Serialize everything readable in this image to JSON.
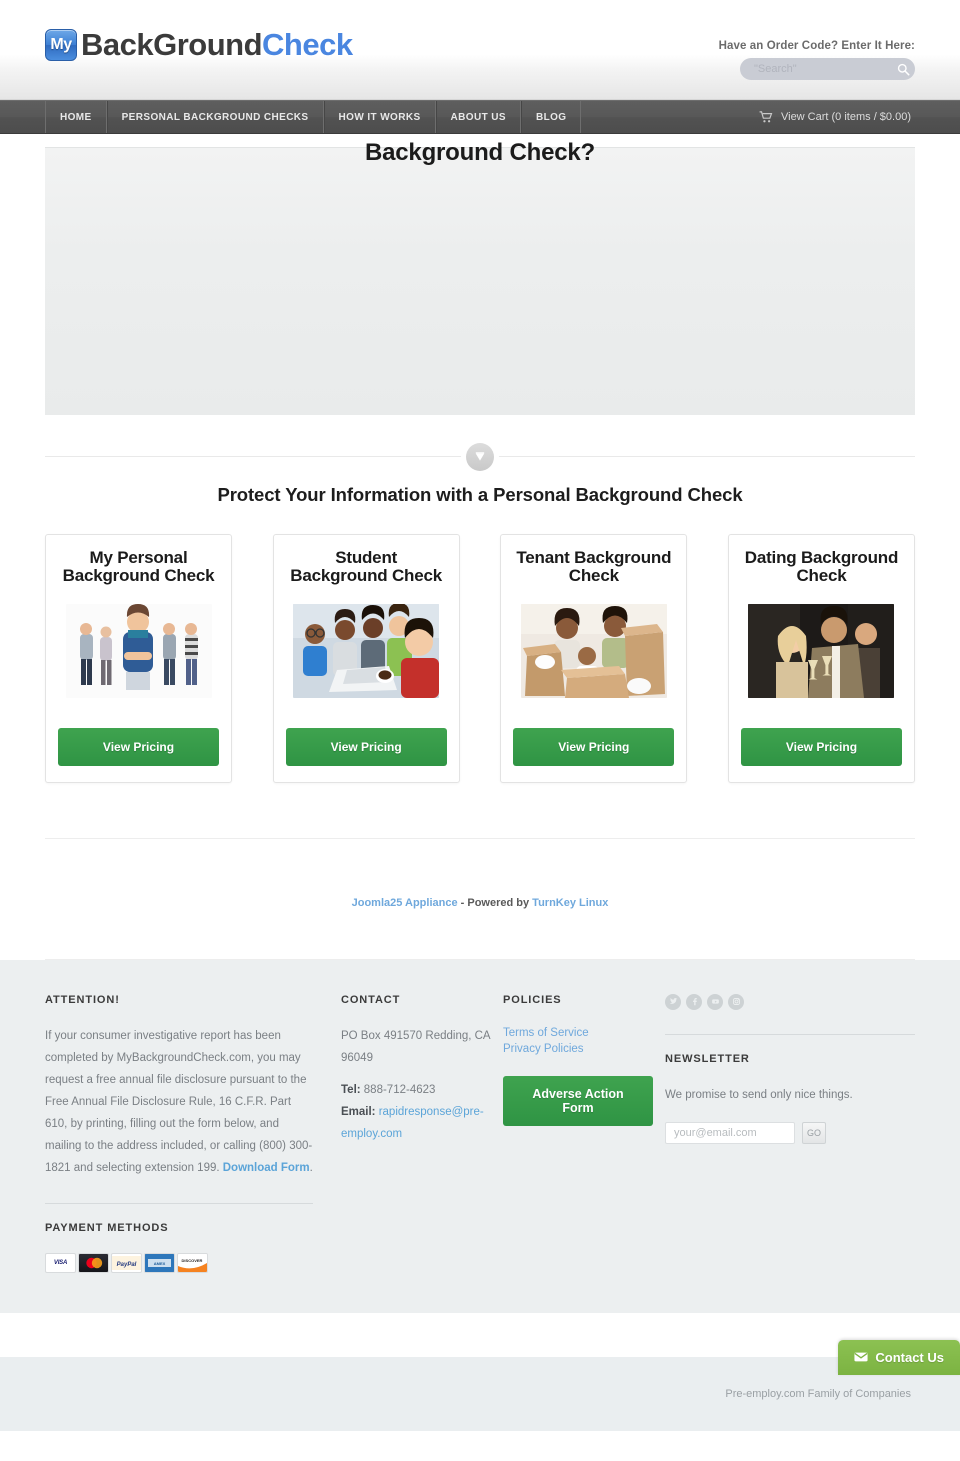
{
  "header": {
    "logo": {
      "badge": "My",
      "dark": "BackGround",
      "blue": "Check"
    },
    "order_code_label": "Have an Order Code? Enter It Here:",
    "search": {
      "placeholder": "\"Search\"",
      "value": "",
      "icon": "search-icon"
    }
  },
  "nav": {
    "items": [
      {
        "label": "HOME"
      },
      {
        "label": "PERSONAL BACKGROUND CHECKS"
      },
      {
        "label": "HOW IT WORKS"
      },
      {
        "label": "ABOUT US"
      },
      {
        "label": "BLOG"
      }
    ],
    "cart": {
      "label": "View Cart (0 items / $0.00)",
      "icon": "cart-icon"
    }
  },
  "hero": {
    "title": "Background Check?"
  },
  "scroll": {
    "icon": "arrow-down-circle-icon"
  },
  "main": {
    "section_title": "Protect Your Information with a Personal Background Check",
    "cards": [
      {
        "title": "My Personal Background Check",
        "button": "View Pricing",
        "image": "group-of-young-people-photo"
      },
      {
        "title": "Student Background Check",
        "button": "View Pricing",
        "image": "students-with-laptop-photo"
      },
      {
        "title": "Tenant Background Check",
        "button": "View Pricing",
        "image": "family-with-moving-boxes-photo"
      },
      {
        "title": "Dating Background Check",
        "button": "View Pricing",
        "image": "couple-toasting-photo"
      }
    ]
  },
  "powered": {
    "prefix": "Joomla25 Appliance",
    "middle": " - Powered by ",
    "suffix": "TurnKey Linux"
  },
  "footer": {
    "attention": {
      "heading": "ATTENTION!",
      "body": "If your consumer investigative report has been completed by MyBackgroundCheck.com, you may request a free annual file disclosure pursuant to the Free Annual File Disclosure Rule, 16 C.F.R. Part 610, by printing, filling out the form below, and mailing to the address included, or calling (800) 300-1821 and selecting extension 199. ",
      "download_link": "Download Form",
      "body_end": "."
    },
    "payment": {
      "heading": "PAYMENT METHODS",
      "cards": [
        "VISA",
        "MasterCard",
        "PayPal",
        "American Express",
        "Discover"
      ]
    },
    "contact": {
      "heading": "CONTACT",
      "address": "PO Box 491570 Redding, CA 96049",
      "tel_label": "Tel:",
      "tel": " 888-712-4623",
      "email_label": "Email:",
      "email": " rapidresponse@pre-employ.com"
    },
    "policies": {
      "heading": "POLICIES",
      "links": [
        "Terms of Service",
        "Privacy Policies"
      ],
      "button": "Adverse Action Form"
    },
    "social": {
      "icons": [
        "twitter-icon",
        "facebook-icon",
        "youtube-icon",
        "instagram-icon"
      ]
    },
    "newsletter": {
      "heading": "NEWSLETTER",
      "text": "We promise to send only nice things.",
      "placeholder": "your@email.com",
      "value": "",
      "go_label": "GO"
    }
  },
  "bottom": {
    "text": "Pre-employ.com Family of Companies"
  },
  "contact_us": {
    "label": "Contact Us",
    "icon": "envelope-icon"
  },
  "colors": {
    "green": "#2f9444",
    "nav_dark": "#555555",
    "link_blue": "#6fa8dc",
    "logo_blue": "#4a86e0",
    "footer_bg": "#eceff0",
    "contact_green": "#8cc152"
  }
}
